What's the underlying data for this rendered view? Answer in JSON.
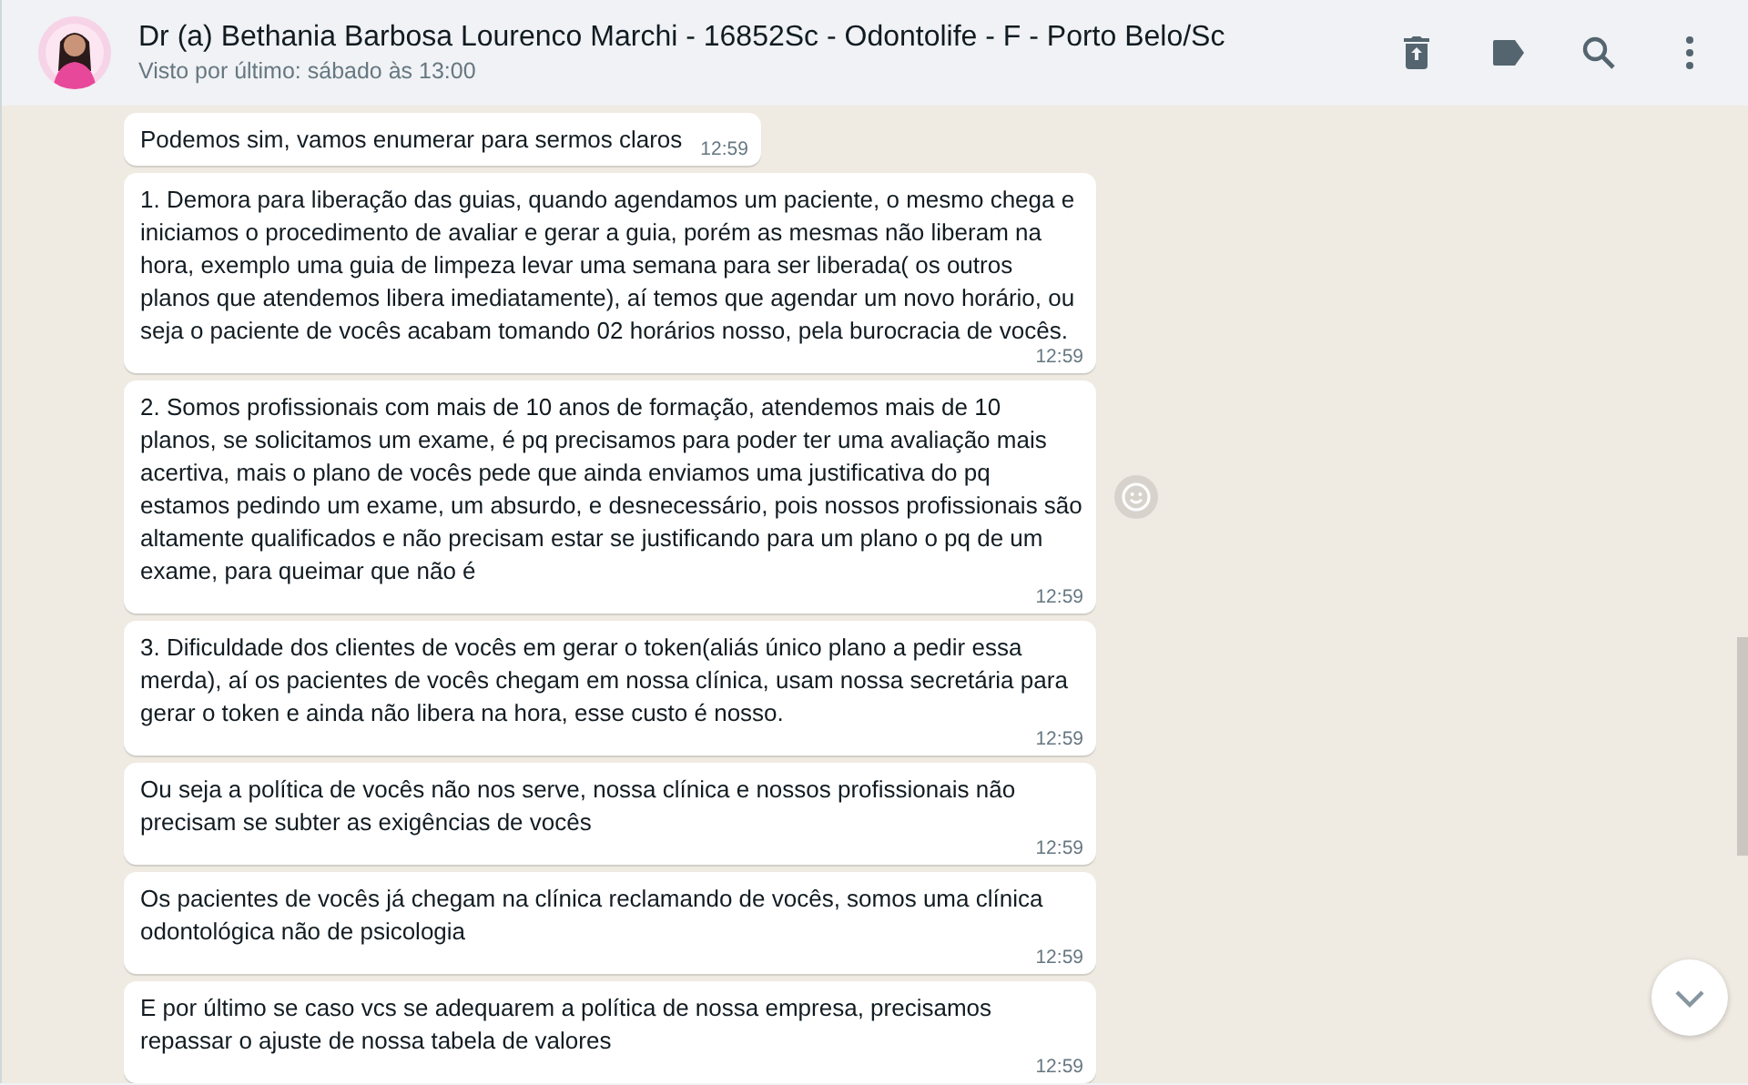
{
  "chat_header": {
    "title": "Dr (a) Bethania Barbosa Lourenco Marchi - 16852Sc - Odontolife - F - Porto Belo/Sc",
    "status": "Visto por último: sábado às 13:00"
  },
  "messages": [
    {
      "text": "Podemos sim, vamos enumerar para sermos claros",
      "time": "12:59",
      "reaction_button": false
    },
    {
      "text": "1. Demora para liberação das guias, quando agendamos um paciente, o mesmo chega e iniciamos o procedimento de avaliar e gerar a guia, porém as mesmas não liberam na hora, exemplo uma guia de limpeza levar uma semana para ser liberada( os outros planos que atendemos libera imediatamente), aí temos que agendar um novo horário, ou seja o paciente de vocês acabam tomando 02 horários nosso, pela burocracia de vocês.",
      "time": "12:59",
      "reaction_button": false
    },
    {
      "text": "2. Somos profissionais com mais de 10 anos de formação, atendemos mais de 10 planos, se solicitamos um exame, é pq precisamos para poder ter uma avaliação mais acertiva, mais o plano de vocês pede que ainda enviamos uma justificativa do pq estamos pedindo um exame, um absurdo, e desnecessário, pois nossos profissionais são altamente qualificados e não precisam estar se justificando para um plano o pq de um exame, para queimar que não é",
      "time": "12:59",
      "reaction_button": true
    },
    {
      "text": "3. Dificuldade dos clientes de vocês em gerar o token(aliás único plano a pedir essa merda), aí os pacientes de vocês chegam em nossa clínica, usam nossa secretária para gerar o token e ainda não libera na hora, esse custo é nosso.",
      "time": "12:59",
      "reaction_button": false
    },
    {
      "text": "Ou seja a política de vocês não nos serve, nossa clínica e nossos profissionais não precisam se subter as exigências de vocês",
      "time": "12:59",
      "reaction_button": false
    },
    {
      "text": "Os pacientes de vocês já chegam na clínica reclamando de vocês, somos uma clínica odontológica não de psicologia",
      "time": "12:59",
      "reaction_button": false
    },
    {
      "text": "E por último se caso vcs se adequarem a política de nossa empresa, precisamos repassar o ajuste de nossa tabela de valores",
      "time": "12:59",
      "reaction_button": false
    }
  ]
}
